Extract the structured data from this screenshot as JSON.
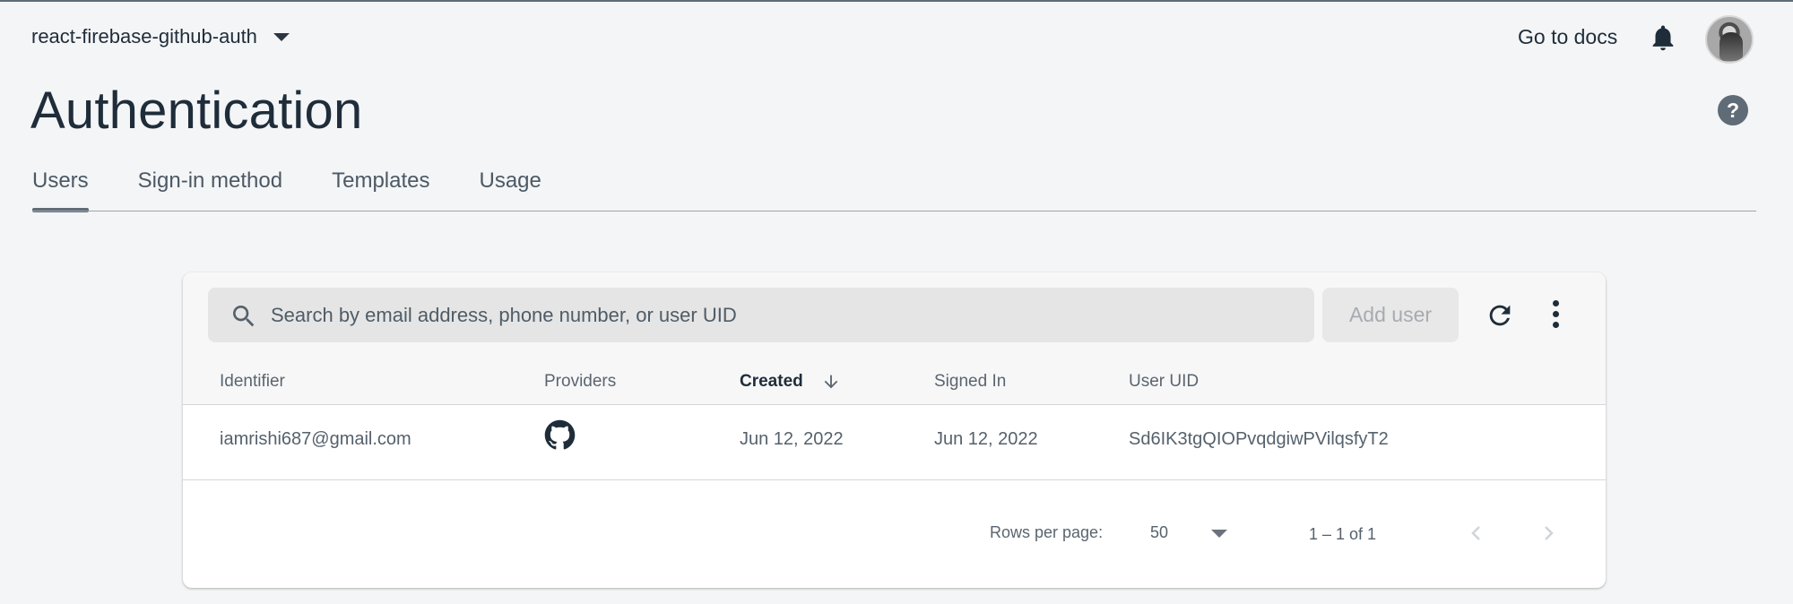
{
  "project": {
    "name": "react-firebase-github-auth"
  },
  "header": {
    "docs_link": "Go to docs"
  },
  "page": {
    "title": "Authentication"
  },
  "tabs": [
    {
      "label": "Users"
    },
    {
      "label": "Sign-in method"
    },
    {
      "label": "Templates"
    },
    {
      "label": "Usage"
    }
  ],
  "search": {
    "placeholder": "Search by email address, phone number, or user UID"
  },
  "toolbar": {
    "add_user_label": "Add user"
  },
  "table": {
    "columns": [
      "Identifier",
      "Providers",
      "Created",
      "Signed In",
      "User UID"
    ],
    "rows": [
      {
        "identifier": "iamrishi687@gmail.com",
        "provider": "github-icon",
        "created": "Jun 12, 2022",
        "signed_in": "Jun 12, 2022",
        "uid": "Sd6IK3tgQIOPvqdgiwPVilqsfyT2"
      }
    ]
  },
  "pagination": {
    "rows_per_page_label": "Rows per page:",
    "rows_per_page_value": "50",
    "range_label": "1 – 1 of 1"
  },
  "icons": {
    "help": "?"
  },
  "colors": {
    "background": "#f4f5f7",
    "text": "#1f2d3a",
    "muted": "#5a6570",
    "accent": "#5f6b76"
  }
}
